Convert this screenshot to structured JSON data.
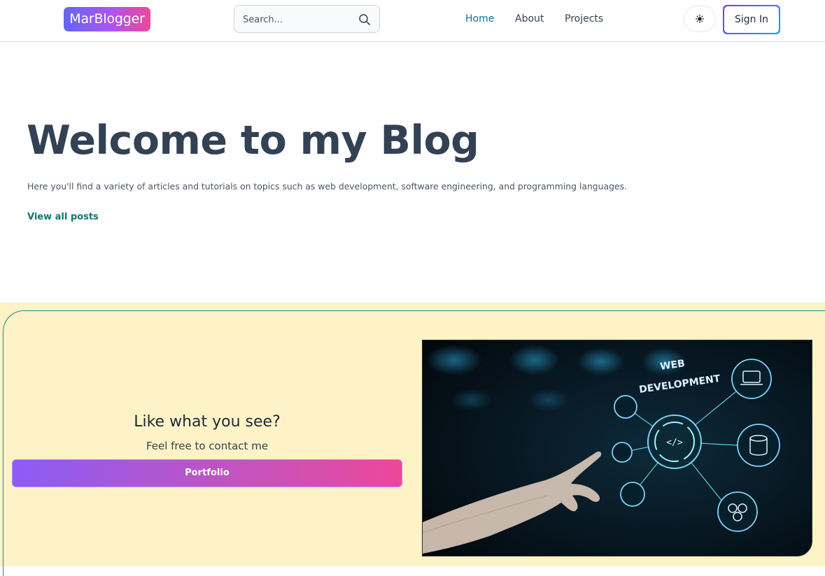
{
  "header": {
    "logo": "MarBlogger",
    "search": {
      "placeholder": "Search..."
    },
    "nav": {
      "home": "Home",
      "about": "About",
      "projects": "Projects"
    },
    "theme_toggle_icon": "sun-icon",
    "sign_in": "Sign In"
  },
  "hero": {
    "title": "Welcome to my Blog",
    "description": "Here you'll find a variety of articles and tutorials on topics such as web development, software engineering, and programming languages.",
    "view_all": "View all posts"
  },
  "cta": {
    "title": "Like what you see?",
    "subtitle": "Feel free to contact me",
    "button": "Portfolio",
    "image_caption_line1": "WEB",
    "image_caption_line2": "DEVELOPMENT"
  },
  "colors": {
    "accent": "#0e7490",
    "cta_background": "#fef3c7",
    "gradient_start": "#8b5cf6",
    "gradient_end": "#ec4899"
  }
}
